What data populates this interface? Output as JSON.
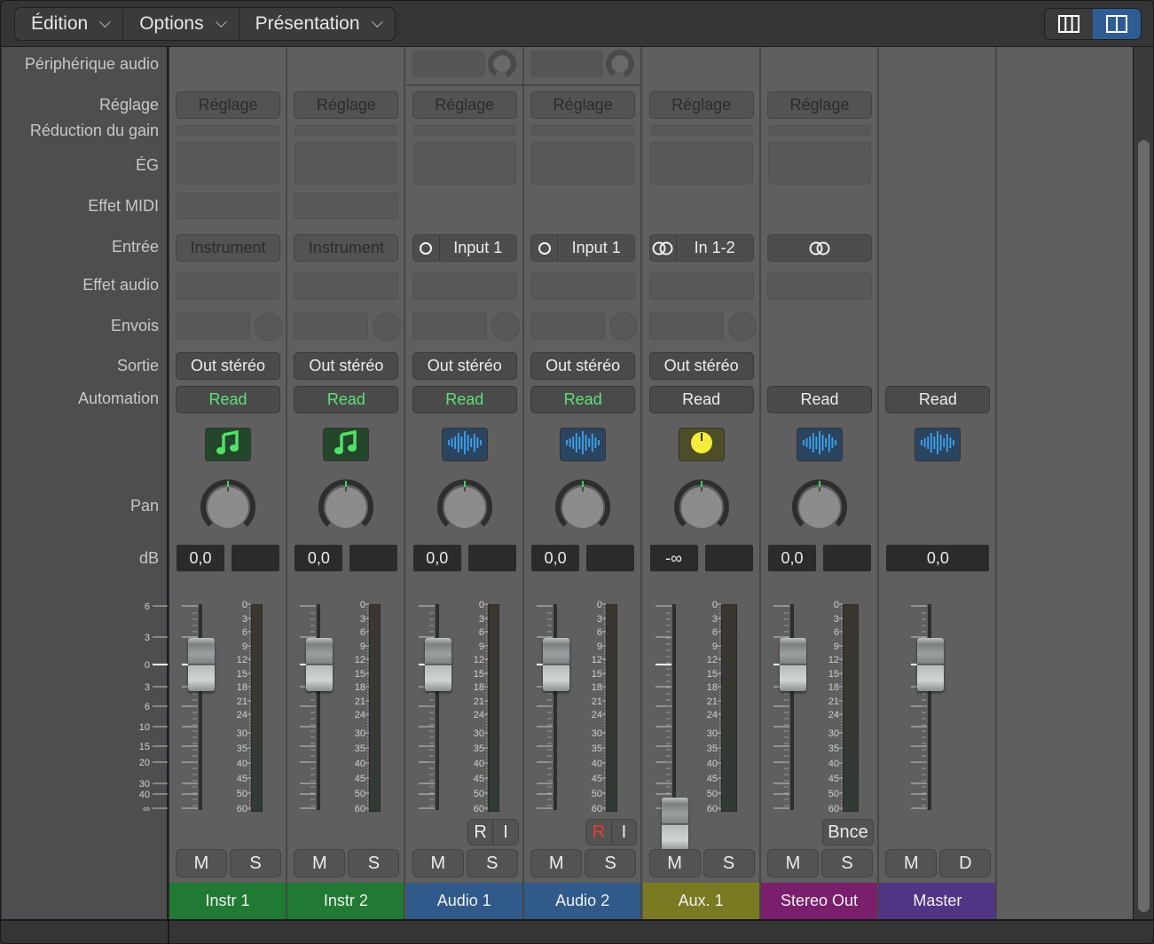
{
  "toolbar": {
    "menus": [
      {
        "label": "Édition",
        "icon": "chevron-down-icon"
      },
      {
        "label": "Options",
        "icon": "chevron-down-icon"
      },
      {
        "label": "Présentation",
        "icon": "chevron-down-icon"
      }
    ],
    "view_switch": [
      {
        "name": "three-column-view",
        "active": false
      },
      {
        "name": "two-column-view",
        "active": true
      }
    ]
  },
  "row_labels": {
    "audio_device": "Périphérique audio",
    "setting": "Réglage",
    "gain_reduction": "Réduction du gain",
    "eq": "ÉG",
    "midi_fx": "Effet MIDI",
    "input": "Entrée",
    "audio_fx": "Effet audio",
    "sends": "Envois",
    "output": "Sortie",
    "automation": "Automation",
    "pan": "Pan",
    "db": "dB"
  },
  "fader_scale": [
    "6",
    "3",
    "0",
    "3",
    "6",
    "10",
    "15",
    "20",
    "30",
    "40",
    "∞"
  ],
  "meter_scale": [
    "0",
    "3",
    "6",
    "9",
    "12",
    "15",
    "18",
    "21",
    "24",
    "30",
    "35",
    "40",
    "45",
    "50",
    "60"
  ],
  "strips": [
    {
      "name": "Instr 1",
      "color": "#207a33",
      "type": "instrument",
      "setting": "Réglage",
      "input": "Instrument",
      "input_icon": "",
      "output": "Out stéréo",
      "automation": "Read",
      "automation_color": "green",
      "icon": "music-note-icon",
      "pan": 0,
      "volume": "0,0",
      "peak": "",
      "fader_db": 0,
      "ri": null,
      "bounce": null,
      "buttons": [
        "M",
        "S"
      ]
    },
    {
      "name": "Instr 2",
      "color": "#207a33",
      "type": "instrument",
      "setting": "Réglage",
      "input": "Instrument",
      "input_icon": "",
      "output": "Out stéréo",
      "automation": "Read",
      "automation_color": "green",
      "icon": "music-note-icon",
      "pan": 0,
      "volume": "0,0",
      "peak": "",
      "fader_db": 0,
      "ri": null,
      "bounce": null,
      "buttons": [
        "M",
        "S"
      ]
    },
    {
      "name": "Audio 1",
      "color": "#2f5a89",
      "type": "audio",
      "setting": "Réglage",
      "input": "Input 1",
      "input_icon": "mono-circle-icon",
      "output": "Out stéréo",
      "automation": "Read",
      "automation_color": "green",
      "icon": "waveform-icon",
      "pan": 0,
      "volume": "0,0",
      "peak": "",
      "fader_db": 0,
      "ri": {
        "r": "R",
        "i": "I",
        "r_active": false
      },
      "bounce": null,
      "buttons": [
        "M",
        "S"
      ]
    },
    {
      "name": "Audio 2",
      "color": "#2f5a89",
      "type": "audio",
      "setting": "Réglage",
      "input": "Input 1",
      "input_icon": "mono-circle-icon",
      "output": "Out stéréo",
      "automation": "Read",
      "automation_color": "green",
      "icon": "waveform-icon",
      "pan": 0,
      "volume": "0,0",
      "peak": "",
      "fader_db": 0,
      "ri": {
        "r": "R",
        "i": "I",
        "r_active": true
      },
      "bounce": null,
      "buttons": [
        "M",
        "S"
      ]
    },
    {
      "name": "Aux. 1",
      "color": "#7a7a22",
      "type": "aux",
      "setting": "Réglage",
      "input": "In 1-2",
      "input_icon": "stereo-circles-icon",
      "output": "Out stéréo",
      "automation": "Read",
      "automation_color": "white",
      "icon": "knob-yellow-icon",
      "pan": 0,
      "volume": "-∞",
      "peak": "",
      "fader_db": "-inf",
      "ri": null,
      "bounce": null,
      "buttons": [
        "M",
        "S"
      ]
    },
    {
      "name": "Stereo Out",
      "color": "#7a1f6b",
      "type": "output",
      "setting": "Réglage",
      "input": "",
      "input_icon": "stereo-circles-icon",
      "output": "",
      "automation": "Read",
      "automation_color": "white",
      "icon": "waveform-icon",
      "pan": 0,
      "volume": "0,0",
      "peak": "",
      "fader_db": 0,
      "ri": null,
      "bounce": "Bnce",
      "buttons": [
        "M",
        "S"
      ]
    },
    {
      "name": "Master",
      "color": "#523484",
      "type": "master",
      "setting": "",
      "input": "",
      "input_icon": "",
      "output": "",
      "automation": "Read",
      "automation_color": "white",
      "icon": "waveform-icon",
      "pan": null,
      "volume": "0,0",
      "peak": null,
      "fader_db": 0,
      "ri": null,
      "bounce": null,
      "buttons": [
        "M",
        "D"
      ]
    }
  ]
}
